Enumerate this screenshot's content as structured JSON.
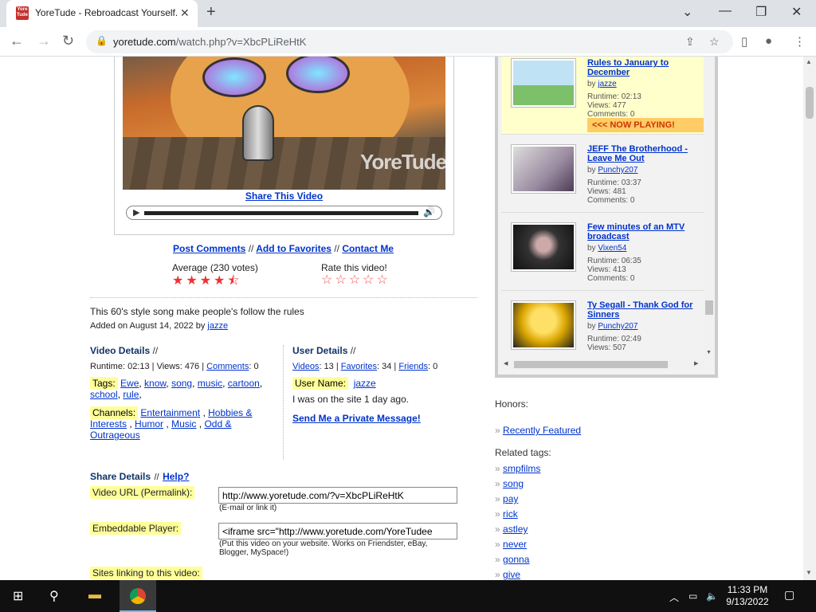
{
  "browser": {
    "tab_title": "YoreTude - Rebroadcast Yourself.",
    "favicon_text": "Yore Tude",
    "url_host": "yoretude.com",
    "url_path": "/watch.php?v=XbcPLiReHtK"
  },
  "player": {
    "watermark": "YoreTude",
    "share_label": "Share This Video"
  },
  "actions": {
    "post_comments": "Post Comments",
    "add_favorites": "Add to Favorites",
    "contact_me": "Contact Me",
    "sep": "//"
  },
  "rating": {
    "average_label": "Average (230 votes)",
    "average_value": 4.5,
    "average_stars": "★★★★⯪",
    "rate_label": "Rate this video!",
    "rate_stars": "☆☆☆☆☆"
  },
  "description": {
    "text": "This 60's style song make people's follow the rules",
    "added_prefix": "Added on August 14, 2022 by",
    "added_user": "jazze"
  },
  "video_details": {
    "heading": "Video Details",
    "sep": "//",
    "runtime_text": "Runtime: 02:13 | Views: 476 |",
    "comments_label": "Comments",
    "comments_value": ": 0",
    "tags_label": "Tags:",
    "tags": [
      "Ewe",
      "know",
      "song",
      "music",
      "cartoon",
      "school",
      "rule"
    ],
    "channels_label": "Channels:",
    "channels": [
      "Entertainment",
      "Hobbies & Interests",
      "Humor",
      "Music",
      "Odd & Outrageous"
    ]
  },
  "user_details": {
    "heading": "User Details",
    "sep": "//",
    "videos_label": "Videos",
    "videos_value": ": 13 |",
    "favorites_label": "Favorites",
    "favorites_value": ": 34 |",
    "friends_label": "Friends",
    "friends_value": ": 0",
    "username_label": "User Name:",
    "username": "jazze",
    "last_seen": "I was on the site 1 day ago.",
    "private_msg": "Send Me a Private Message!"
  },
  "share_details": {
    "heading": "Share Details",
    "sep": "//",
    "help": "Help?",
    "url_label": "Video URL (Permalink):",
    "url_value": "http://www.yoretude.com/?v=XbcPLiReHtK",
    "url_note": "(E-mail or link it)",
    "embed_label": "Embeddable Player:",
    "embed_value": "<iframe src=\"http://www.yoretude.com/YoreTudee",
    "embed_note": "(Put this video on your website. Works on Friendster, eBay, Blogger, MySpace!)",
    "sites_label": "Sites linking to this video:"
  },
  "related": [
    {
      "title": "Rules to January to December",
      "by": "by",
      "user": "jazze",
      "runtime": "Runtime: 02:13",
      "views": "Views: 477",
      "comments": "Comments: 0",
      "now_playing": "<<< NOW PLAYING!",
      "bg": "#ffffcc"
    },
    {
      "title": "JEFF The Brotherhood - Leave Me Out",
      "by": "by",
      "user": "Punchy207",
      "runtime": "Runtime: 03:37",
      "views": "Views: 481",
      "comments": "Comments: 0",
      "bg": "#f2f2f2"
    },
    {
      "title": "Few minutes of an MTV broadcast",
      "by": "by",
      "user": "Vixen54",
      "runtime": "Runtime: 06:35",
      "views": "Views: 413",
      "comments": "Comments: 0",
      "bg": "#f2f2f2"
    },
    {
      "title": "Ty Segall - Thank God for Sinners",
      "by": "by",
      "user": "Punchy207",
      "runtime": "Runtime: 02:49",
      "views": "Views: 507",
      "comments": "",
      "bg": "#f2f2f2"
    }
  ],
  "sidebar": {
    "honors_label": "Honors:",
    "recently_featured": "Recently Featured",
    "related_tags_label": "Related tags:",
    "bullet": "»",
    "tags": [
      "smpfilms",
      "song",
      "pay",
      "rick",
      "astley",
      "never",
      "gonna",
      "give"
    ]
  },
  "taskbar": {
    "time": "11:33 PM",
    "date": "9/13/2022"
  }
}
